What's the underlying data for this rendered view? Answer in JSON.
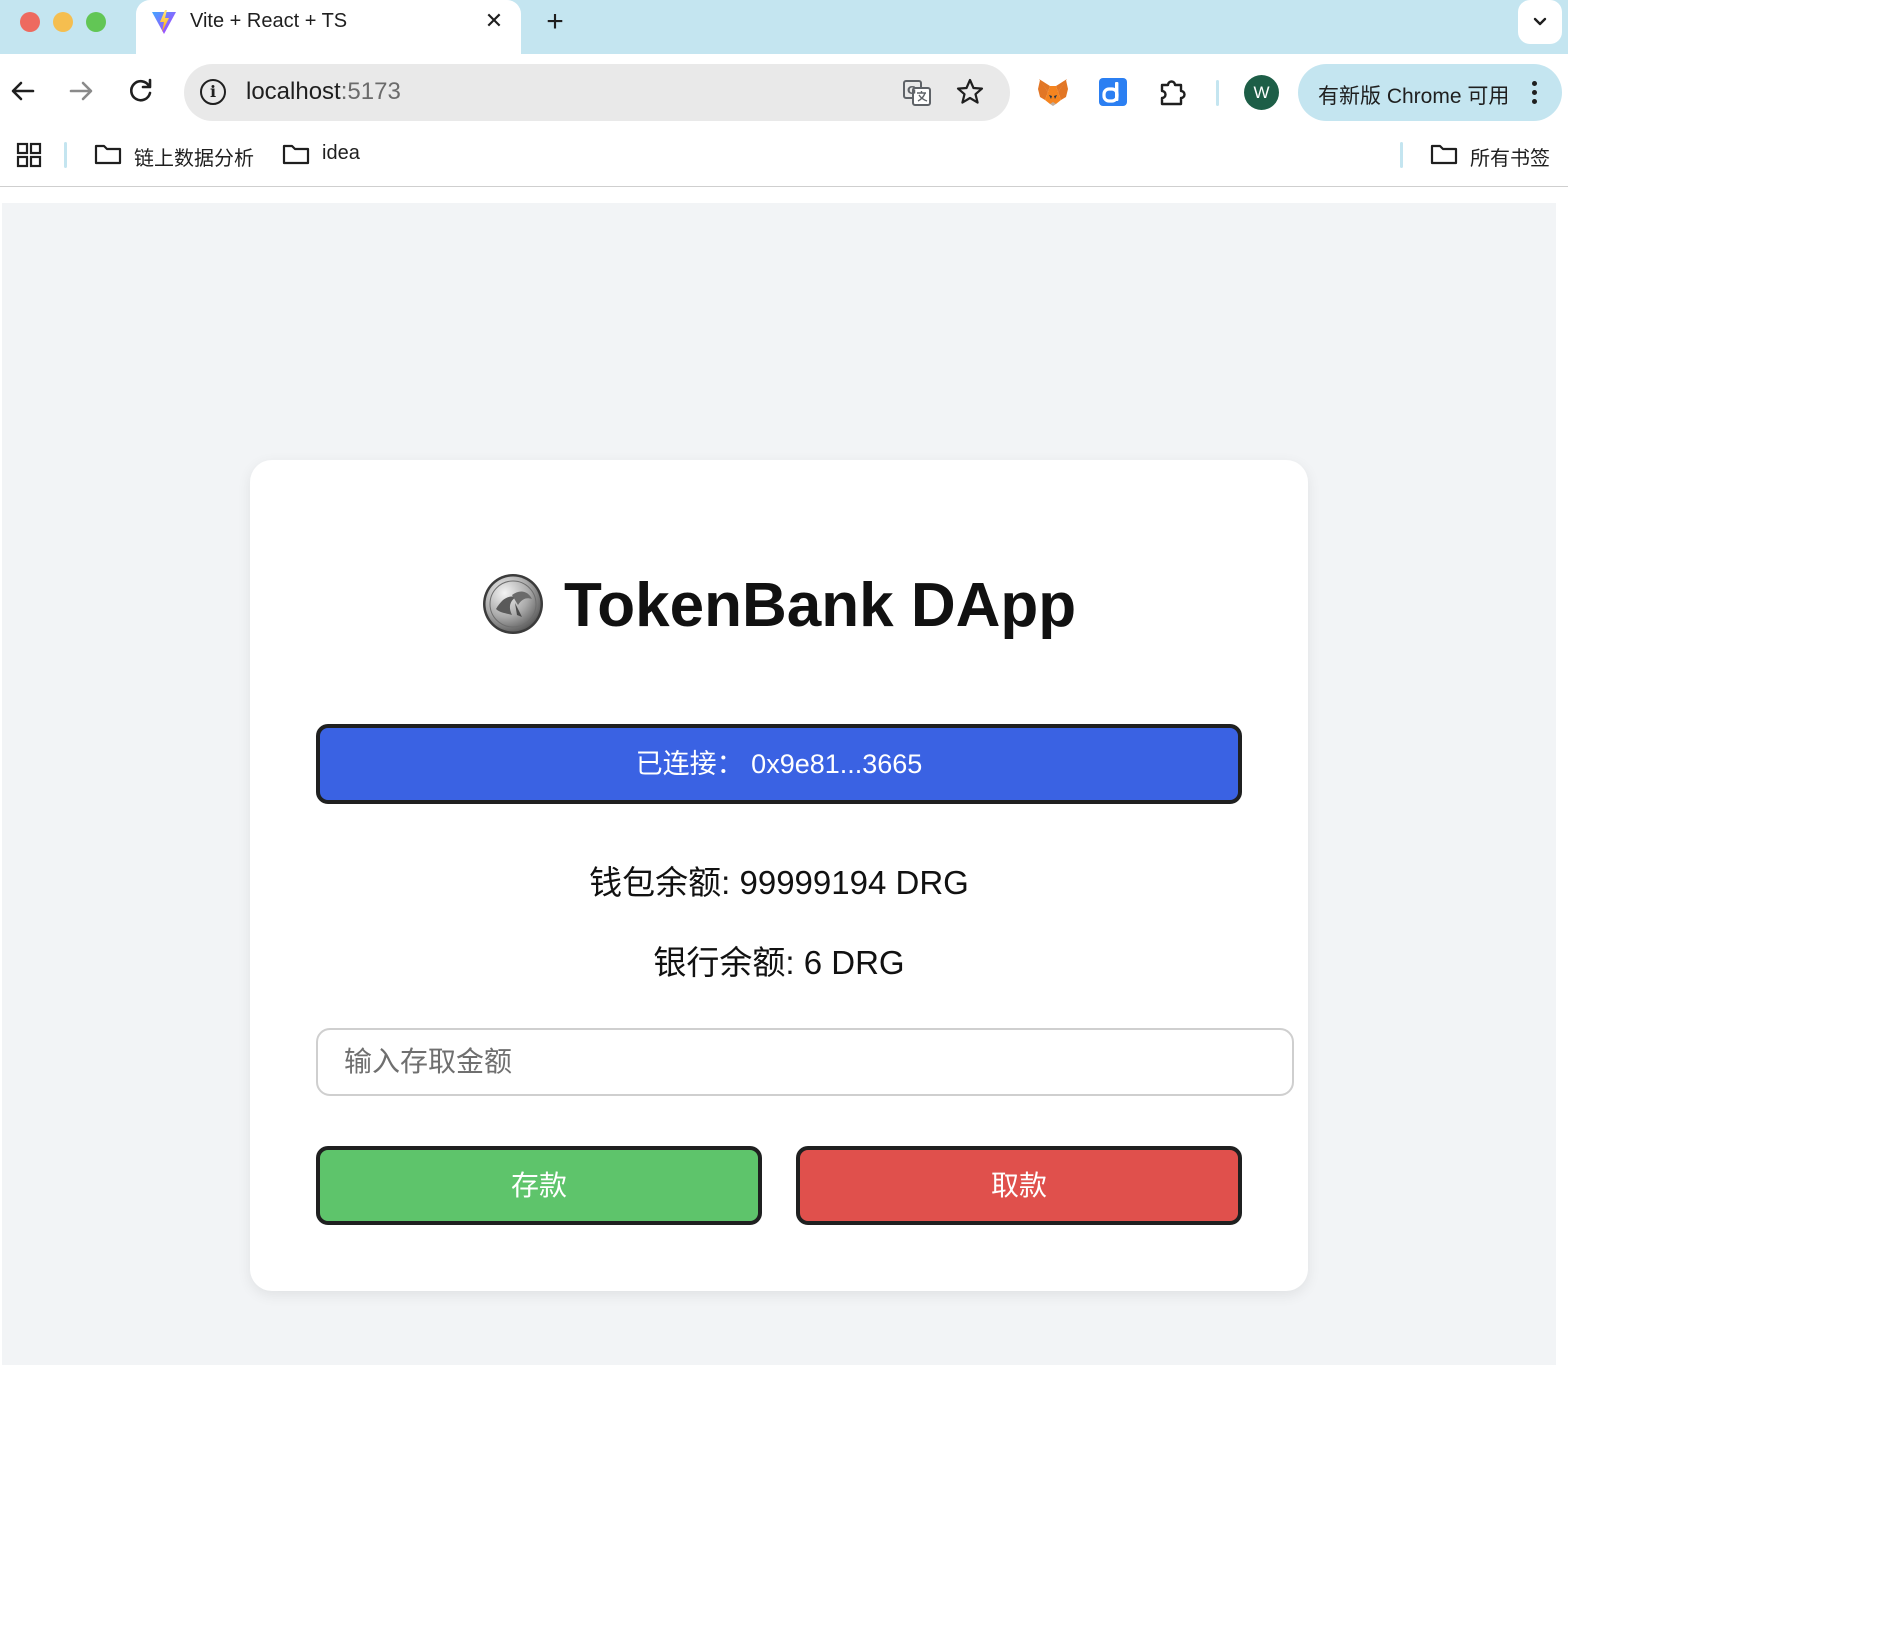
{
  "browser": {
    "tab": {
      "title": "Vite + React + TS",
      "close_glyph": "✕"
    },
    "new_tab_glyph": "+",
    "address": {
      "host": "localhost",
      "port": ":5173"
    },
    "update_button": {
      "label": "有新版 Chrome 可用"
    },
    "profile_initial": "W",
    "bookmarks": [
      {
        "label": "链上数据分析"
      },
      {
        "label": "idea"
      }
    ],
    "all_bookmarks_label": "所有书签",
    "colors": {
      "tabstrip": "#c4e5f0",
      "omnibox": "#e9e9e9",
      "profile": "#1d5e47"
    }
  },
  "app": {
    "title": "TokenBank DApp",
    "connect_button": "已连接： 0x9e81...3665",
    "wallet_balance": "钱包余额: 99999194 DRG",
    "bank_balance": "银行余额: 6 DRG",
    "amount_placeholder": "输入存取金额",
    "deposit_label": "存款",
    "withdraw_label": "取款",
    "colors": {
      "connect": "#3a62e3",
      "deposit": "#5ec46b",
      "withdraw": "#e0504c",
      "background": "#f2f4f6"
    }
  }
}
